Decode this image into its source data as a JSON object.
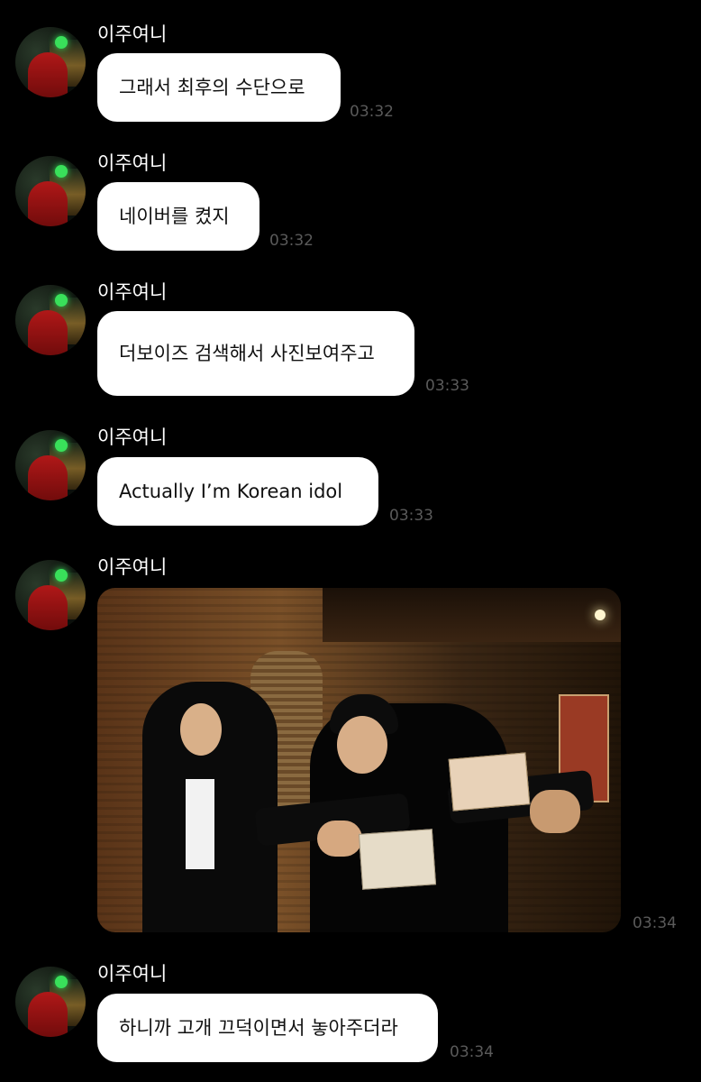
{
  "sender_name": "이주여니",
  "messages": [
    {
      "text": "그래서 최후의 수단으로",
      "time": "03:32"
    },
    {
      "text": "네이버를 켰지",
      "time": "03:32"
    },
    {
      "text": "더보이즈 검색해서 사진보여주고",
      "time": "03:33"
    },
    {
      "text": "Actually I’m Korean idol",
      "time": "03:33"
    },
    {
      "image": "photo-two-people-holding-id-cards",
      "time": "03:34"
    },
    {
      "text": "하니까 고개 끄덕이면서 놓아주더라",
      "time": "03:34"
    }
  ],
  "colors": {
    "background": "#000000",
    "bubble": "#ffffff",
    "bubble_text": "#111111",
    "name_text": "#ffffff",
    "time_text": "#5a5a5a"
  }
}
